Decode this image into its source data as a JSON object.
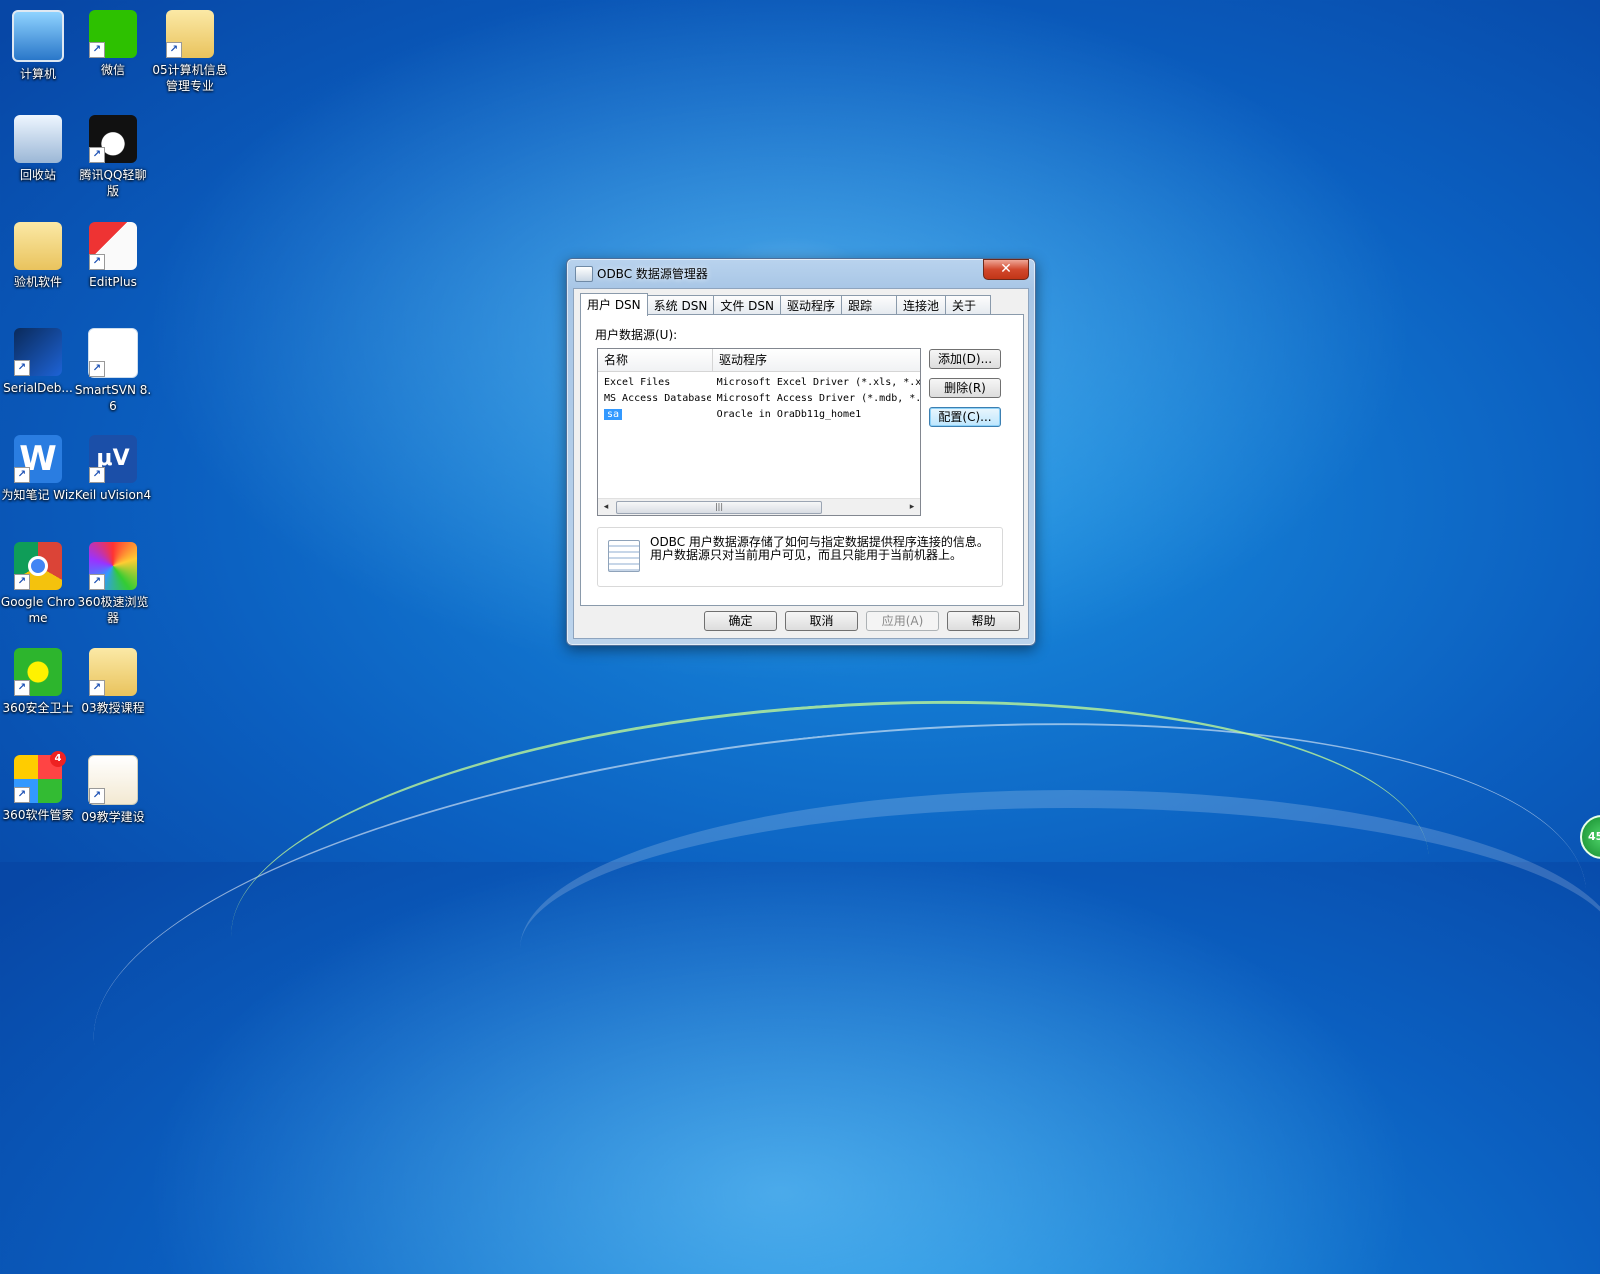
{
  "desktop": {
    "icons": [
      {
        "label": "计算机"
      },
      {
        "label": "微信"
      },
      {
        "label": "05计算机信息管理专业"
      },
      {
        "label": "回收站"
      },
      {
        "label": "腾讯QQ轻聊版"
      },
      {
        "label": "验机软件"
      },
      {
        "label": "EditPlus"
      },
      {
        "label": "SerialDeb..."
      },
      {
        "label": "SmartSVN 8.6"
      },
      {
        "label": "为知笔记 Wiz"
      },
      {
        "label": "Keil uVision4"
      },
      {
        "label": "Google Chrome"
      },
      {
        "label": "360极速浏览器"
      },
      {
        "label": "360安全卫士"
      },
      {
        "label": "03教授课程"
      },
      {
        "label": "360软件管家"
      },
      {
        "label": "09教学建设"
      }
    ],
    "badge_360m": "4",
    "gadget_text": "45"
  },
  "dialog": {
    "title": "ODBC 数据源管理器",
    "close_glyph": "✕",
    "tabs": [
      {
        "label": "用户 DSN"
      },
      {
        "label": "系统 DSN"
      },
      {
        "label": "文件 DSN"
      },
      {
        "label": "驱动程序"
      },
      {
        "label": "跟踪"
      },
      {
        "label": "连接池"
      },
      {
        "label": "关于"
      }
    ],
    "group_label": "用户数据源(U):",
    "columns": {
      "name": "名称",
      "driver": "驱动程序"
    },
    "rows": [
      {
        "name": "Excel Files",
        "driver": "Microsoft Excel Driver (*.xls, *.x"
      },
      {
        "name": "MS Access Database",
        "driver": "Microsoft Access Driver (*.mdb, *."
      },
      {
        "name": "sa",
        "driver": "Oracle in OraDb11g_home1"
      }
    ],
    "scroll": {
      "left": "◂",
      "right": "▸",
      "thumb": "|||"
    },
    "side_buttons": {
      "add": "添加(D)...",
      "remove": "删除(R)",
      "configure": "配置(C)..."
    },
    "info_text": "ODBC 用户数据源存储了如何与指定数据提供程序连接的信息。用户数据源只对当前用户可见，而且只能用于当前机器上。",
    "bottom_buttons": {
      "ok": "确定",
      "cancel": "取消",
      "apply": "应用(A)",
      "help": "帮助"
    }
  }
}
